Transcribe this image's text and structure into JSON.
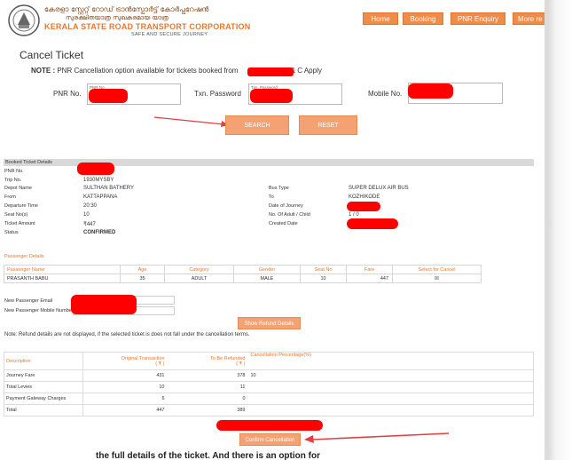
{
  "header": {
    "logo_malayalam_line1": "കേരളാ സ്റ്റേറ്റ് റോഡ് ട്രാൻസ്പോർട്ട് കോർപ്പറേഷൻ",
    "logo_malayalam_line2": "സുരക്ഷിതയാത്ര സുഖകരമായ യാത്ര",
    "logo_english": "KERALA STATE ROAD TRANSPORT CORPORATION",
    "logo_tagline": "SAFE AND SECURE JOURNEY",
    "nav": [
      "Home",
      "Booking",
      "PNR Enquiry",
      "More re"
    ]
  },
  "cancel": {
    "title": "Cancel Ticket",
    "note_label": "NOTE :",
    "note_text": "PNR Cancellation option available for tickets booked from",
    "note_tail": "T & C Apply",
    "pnr_label": "PNR No.",
    "pnr_small": "PNR No.",
    "txn_label": "Txn. Password",
    "txn_small": "Txn. Password",
    "mobile_label": "Mobile No.",
    "search_button": "SEARCH",
    "reset_button": "RESET"
  },
  "booked": {
    "section_title": "Booked Ticket Details",
    "left_rows": [
      {
        "label": "PNR No.",
        "value": ""
      },
      {
        "label": "Trip No.",
        "value": "1930MYSBY"
      },
      {
        "label": "Depot Name",
        "value": "SULTHAN BATHERY"
      },
      {
        "label": "From",
        "value": "KATTAPPANA"
      },
      {
        "label": "Departure Time",
        "value": "20:30"
      },
      {
        "label": "Seat No(s)",
        "value": "10"
      },
      {
        "label": "Ticket Amount",
        "value": "₹447"
      },
      {
        "label": "Status",
        "value": "CONFIRMED"
      }
    ],
    "right_rows": [
      {
        "label": "Bus Type",
        "value": "SUPER DELUX AIR BUS"
      },
      {
        "label": "To",
        "value": "KOZHIKODE"
      },
      {
        "label": "Date of Journey",
        "value": ""
      },
      {
        "label": "No. Of Adult / Child",
        "value": "1 / 0"
      },
      {
        "label": "Created Date",
        "value": ""
      }
    ]
  },
  "passengers": {
    "title": "Passenger Details",
    "headers": [
      "Passenger Name",
      "Age",
      "Category",
      "Gender",
      "Seat No",
      "Fare",
      "Select for Cancel"
    ],
    "rows": [
      [
        "PRASANTH BABU",
        "35",
        "ADULT",
        "MALE",
        "10",
        "447",
        "☒"
      ]
    ],
    "new_email_label": "New Passenger Email",
    "new_mobile_label": "New Passenger Mobile Number",
    "show_refund_button": "Show Refund Details",
    "note": "Note: Refund details are not displayed, if the selected ticket is does not fall under the cancellation terms."
  },
  "refund": {
    "headers": [
      "Description",
      "Original Transaction\n( ₹ )",
      "To Be Refunded\n( ₹ )",
      "Cancellation Percentage(%)"
    ],
    "rows": [
      [
        "Journey Fare",
        "431",
        "378",
        "10"
      ],
      [
        "Total Levies",
        "10",
        "11",
        ""
      ],
      [
        "Payment Gateway Charges",
        "6",
        "0",
        ""
      ],
      [
        "Total",
        "447",
        "389",
        ""
      ]
    ],
    "confirm_button": "Confirm Cancellation"
  },
  "bottom_caption": "the full details of the ticket. And there is an option for"
}
